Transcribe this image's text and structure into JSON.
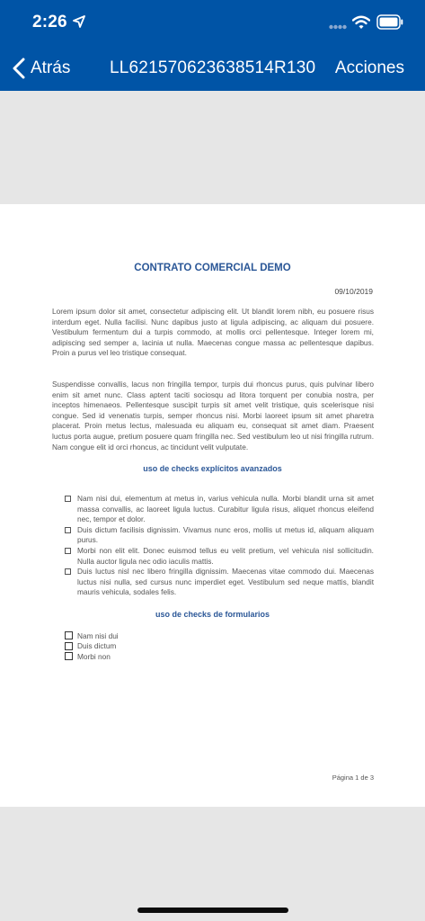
{
  "status_bar": {
    "time": "2:26"
  },
  "nav": {
    "back_label": "Atrás",
    "title": "LL621570623638514R130",
    "actions_label": "Acciones"
  },
  "document": {
    "title": "CONTRATO COMERCIAL DEMO",
    "date": "09/10/2019",
    "paragraphs": [
      "Lorem ipsum dolor sit amet, consectetur adipiscing elit. Ut blandit lorem nibh, eu posuere risus interdum eget. Nulla facilisi. Nunc dapibus justo at ligula adipiscing, ac aliquam dui posuere. Vestibulum fermentum dui a turpis commodo, at mollis orci pellentesque. Integer lorem mi, adipiscing sed semper a, lacinia ut nulla. Maecenas congue massa ac pellentesque dapibus. Proin a purus vel leo tristique consequat.",
      "Suspendisse convallis, lacus non fringilla tempor, turpis dui rhoncus purus, quis pulvinar libero enim sit amet nunc. Class aptent taciti sociosqu ad litora torquent per conubia nostra, per inceptos himenaeos. Pellentesque suscipit turpis sit amet velit tristique, quis scelerisque nisi congue. Sed id venenatis turpis, semper rhoncus nisi. Morbi laoreet ipsum sit amet pharetra placerat. Proin metus lectus, malesuada eu aliquam eu, consequat sit amet diam. Praesent luctus porta augue, pretium posuere quam fringilla nec. Sed vestibulum leo ut nisi fringilla rutrum. Nam congue elit id orci rhoncus, ac tincidunt velit vulputate."
    ],
    "section_checks_title": "uso de checks explícitos avanzados",
    "check_items": [
      "Nam nisi dui, elementum at metus in, varius vehicula nulla. Morbi blandit urna sit amet massa convallis, ac laoreet ligula luctus. Curabitur ligula risus, aliquet rhoncus eleifend nec, tempor et dolor.",
      "Duis dictum facilisis dignissim. Vivamus nunc eros, mollis ut metus id, aliquam aliquam purus.",
      "Morbi non elit elit. Donec euismod tellus eu velit pretium, vel vehicula nisl sollicitudin. Nulla auctor ligula nec odio iaculis mattis.",
      "Duis luctus nisl nec libero fringilla dignissim. Maecenas vitae commodo dui. Maecenas luctus nisi nulla, sed cursus nunc imperdiet eget. Vestibulum sed neque mattis, blandit mauris vehicula, sodales felis."
    ],
    "section_form_title": "uso de checks de formularios",
    "form_checks": [
      "Nam nisi dui",
      "Duis dictum",
      "Morbi non"
    ],
    "page_label": "Página 1 de 3"
  },
  "colors": {
    "nav_bg": "#0054a6",
    "heading": "#2b5797",
    "viewer_bg": "#e6e6e6"
  }
}
